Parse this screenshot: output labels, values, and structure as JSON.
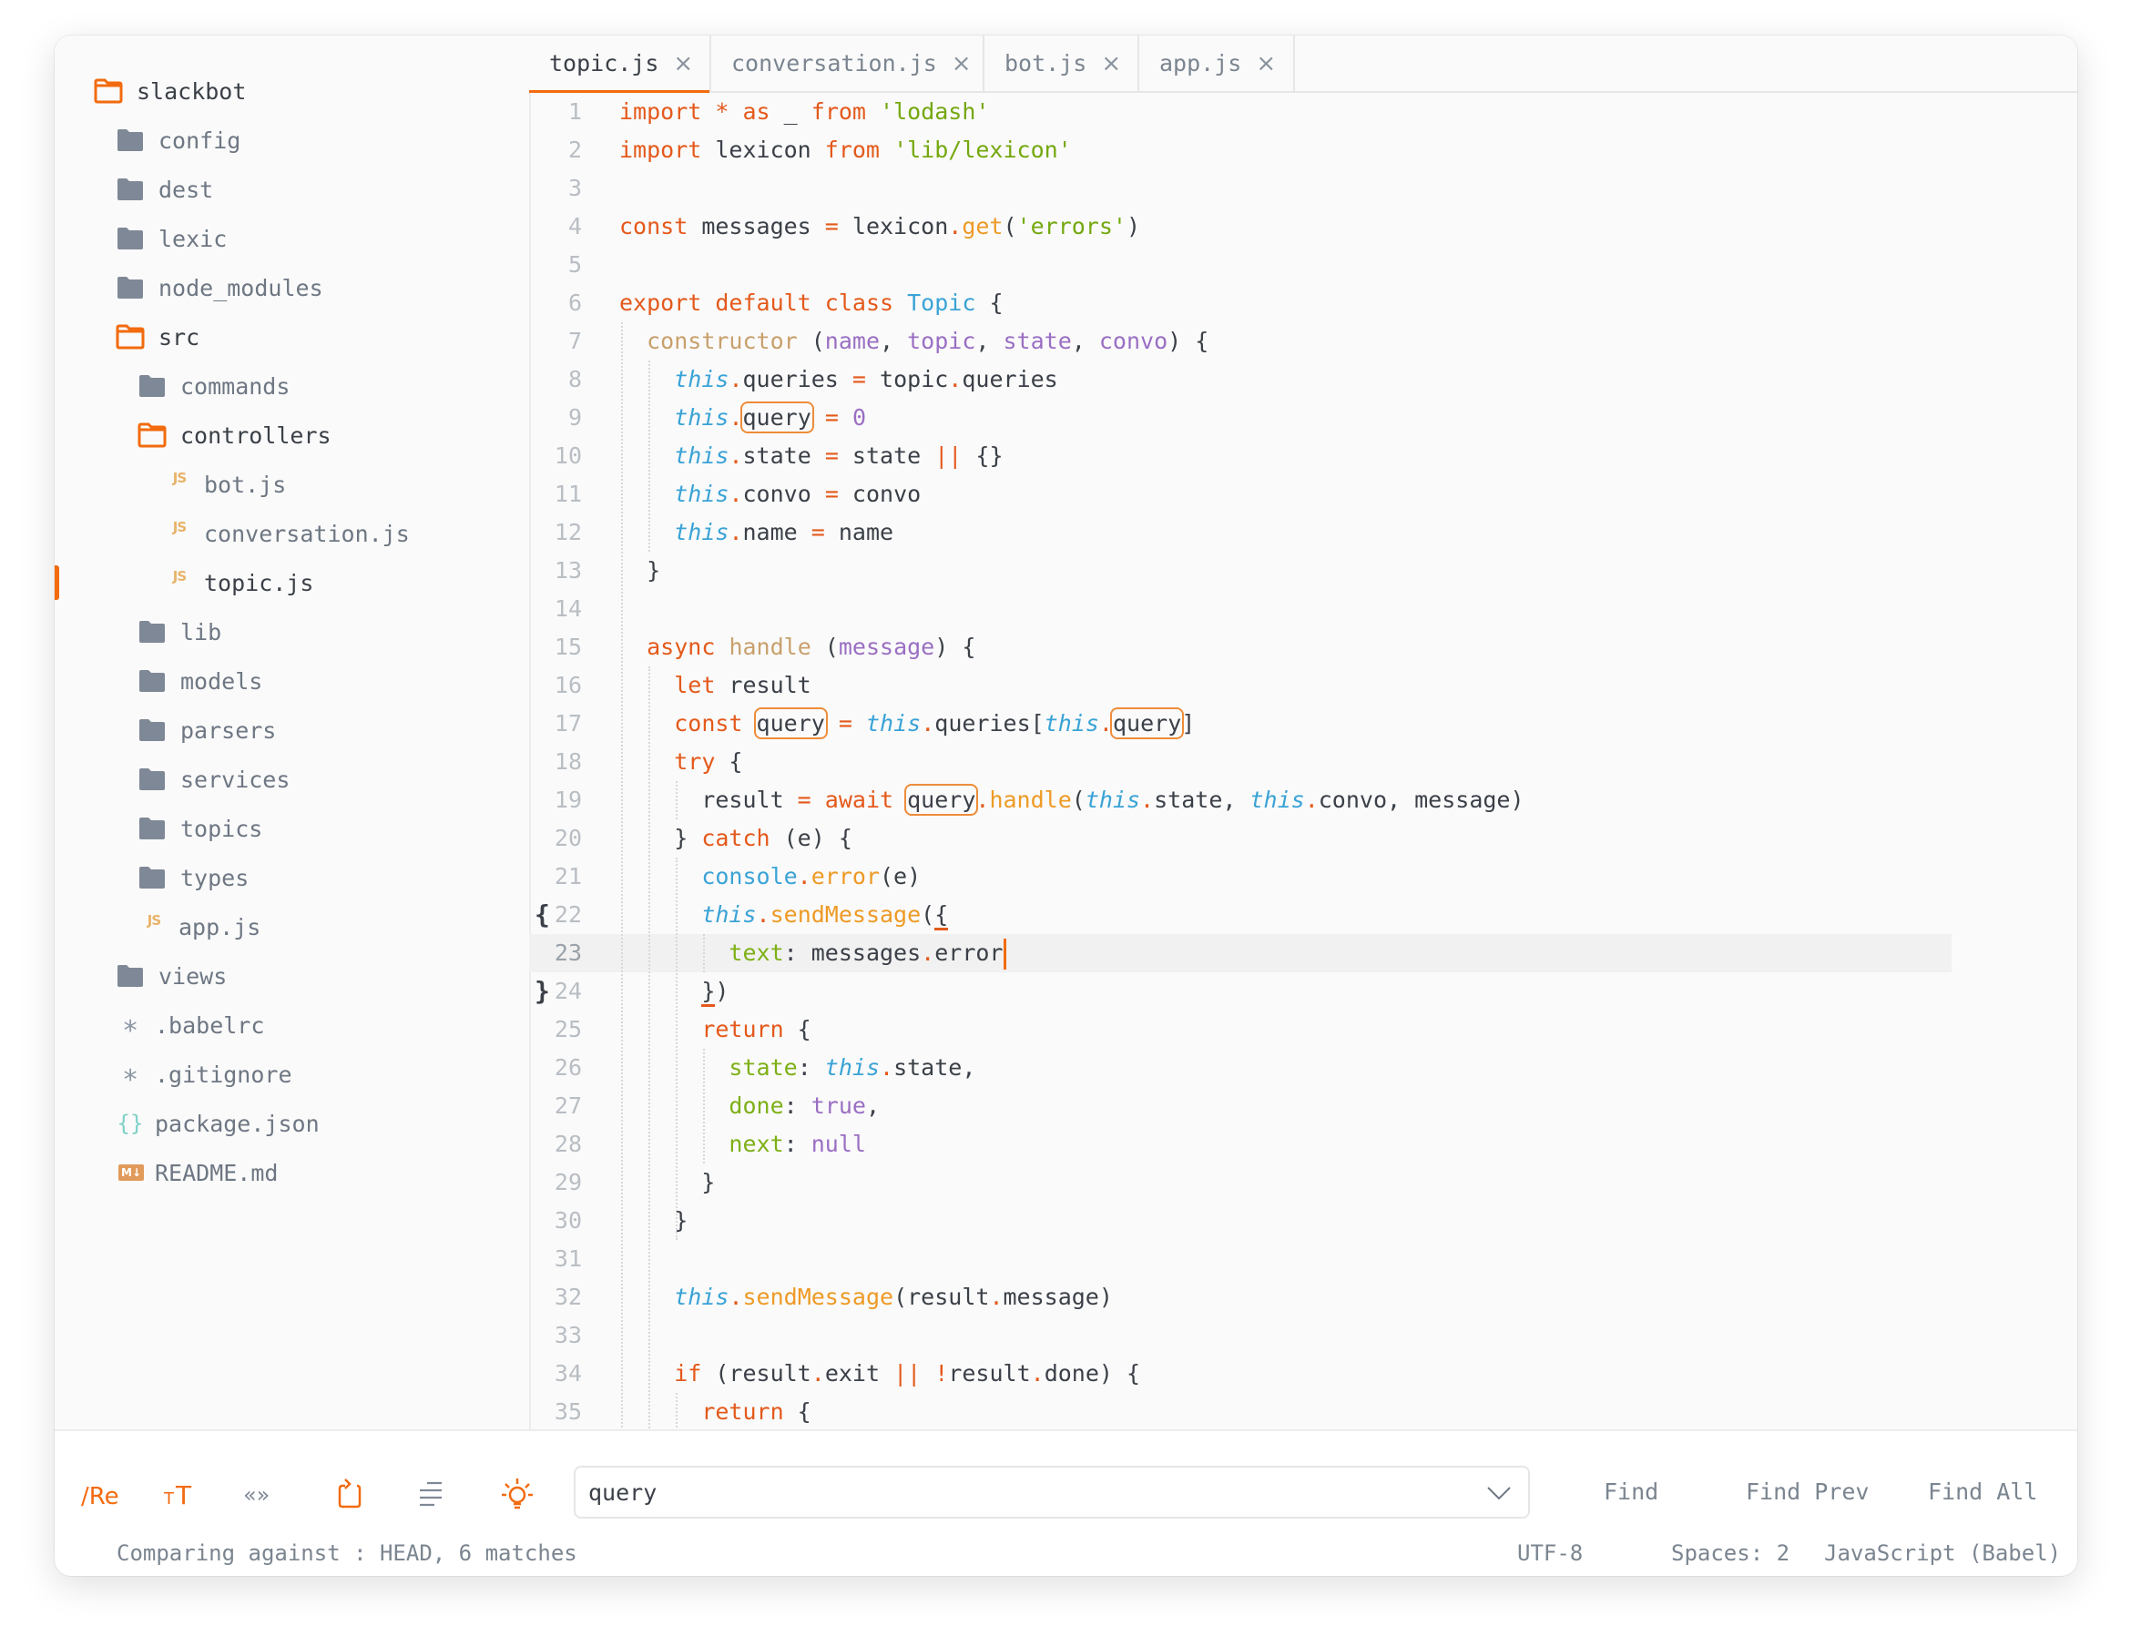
{
  "sidebar": {
    "items": [
      {
        "label": "slackbot",
        "icon": "folder-open-icon",
        "kind": "folder-open",
        "depth": 0
      },
      {
        "label": "config",
        "icon": "folder-icon",
        "kind": "folder",
        "depth": 1
      },
      {
        "label": "dest",
        "icon": "folder-icon",
        "kind": "folder",
        "depth": 1
      },
      {
        "label": "lexic",
        "icon": "folder-icon",
        "kind": "folder",
        "depth": 1
      },
      {
        "label": "node_modules",
        "icon": "folder-icon",
        "kind": "folder",
        "depth": 1
      },
      {
        "label": "src",
        "icon": "folder-open-icon",
        "kind": "folder-open",
        "depth": 1
      },
      {
        "label": "commands",
        "icon": "folder-icon",
        "kind": "folder",
        "depth": 2
      },
      {
        "label": "controllers",
        "icon": "folder-open-icon",
        "kind": "folder-open",
        "depth": 2
      },
      {
        "label": "bot.js",
        "icon": "js-file-icon",
        "kind": "js",
        "depth": 3
      },
      {
        "label": "conversation.js",
        "icon": "js-file-icon",
        "kind": "js",
        "depth": 3
      },
      {
        "label": "topic.js",
        "icon": "js-file-icon",
        "kind": "js",
        "depth": 3,
        "active": true
      },
      {
        "label": "lib",
        "icon": "folder-icon",
        "kind": "folder",
        "depth": 2
      },
      {
        "label": "models",
        "icon": "folder-icon",
        "kind": "folder",
        "depth": 2
      },
      {
        "label": "parsers",
        "icon": "folder-icon",
        "kind": "folder",
        "depth": 2
      },
      {
        "label": "services",
        "icon": "folder-icon",
        "kind": "folder",
        "depth": 2
      },
      {
        "label": "topics",
        "icon": "folder-icon",
        "kind": "folder",
        "depth": 2
      },
      {
        "label": "types",
        "icon": "folder-icon",
        "kind": "folder",
        "depth": 2
      },
      {
        "label": "app.js",
        "icon": "js-file-icon",
        "kind": "js",
        "depth": 2
      },
      {
        "label": "views",
        "icon": "folder-icon",
        "kind": "folder",
        "depth": 1
      },
      {
        "label": ".babelrc",
        "icon": "asterisk-icon",
        "kind": "star",
        "depth": 1
      },
      {
        "label": ".gitignore",
        "icon": "asterisk-icon",
        "kind": "star",
        "depth": 1
      },
      {
        "label": "package.json",
        "icon": "json-braces-icon",
        "kind": "json",
        "depth": 1
      },
      {
        "label": "README.md",
        "icon": "markdown-icon",
        "kind": "md",
        "depth": 1
      }
    ],
    "js_badge": "JS",
    "md_badge": "M↓"
  },
  "tabs": [
    {
      "label": "topic.js",
      "active": true
    },
    {
      "label": "conversation.js",
      "active": false
    },
    {
      "label": "bot.js",
      "active": false
    },
    {
      "label": "app.js",
      "active": false
    }
  ],
  "editor": {
    "current_line": 23,
    "fold_markers": {
      "22": "{",
      "24": "}"
    },
    "lines": [
      [
        [
          "k",
          "import"
        ],
        [
          "t",
          " "
        ],
        [
          "k",
          "*"
        ],
        [
          "t",
          " "
        ],
        [
          "k",
          "as"
        ],
        [
          "t",
          " _ "
        ],
        [
          "k",
          "from"
        ],
        [
          "t",
          " "
        ],
        [
          "s",
          "'lodash'"
        ]
      ],
      [
        [
          "k",
          "import"
        ],
        [
          "t",
          " lexicon "
        ],
        [
          "k",
          "from"
        ],
        [
          "t",
          " "
        ],
        [
          "s",
          "'lib/lexicon'"
        ]
      ],
      [],
      [
        [
          "k",
          "const"
        ],
        [
          "t",
          " messages "
        ],
        [
          "op",
          "="
        ],
        [
          "t",
          " lexicon"
        ],
        [
          "op",
          "."
        ],
        [
          "f",
          "get"
        ],
        [
          "t",
          "("
        ],
        [
          "s",
          "'errors'"
        ],
        [
          "t",
          ")"
        ]
      ],
      [],
      [
        [
          "k",
          "export"
        ],
        [
          "t",
          " "
        ],
        [
          "k",
          "default"
        ],
        [
          "t",
          " "
        ],
        [
          "k",
          "class"
        ],
        [
          "t",
          " "
        ],
        [
          "cls",
          "Topic"
        ],
        [
          "t",
          " {"
        ]
      ],
      [
        [
          "t",
          "  "
        ],
        [
          "ctor",
          "constructor"
        ],
        [
          "t",
          " ("
        ],
        [
          "p",
          "name"
        ],
        [
          "t",
          ", "
        ],
        [
          "p",
          "topic"
        ],
        [
          "t",
          ", "
        ],
        [
          "p",
          "state"
        ],
        [
          "t",
          ", "
        ],
        [
          "p",
          "convo"
        ],
        [
          "t",
          ") {"
        ]
      ],
      [
        [
          "t",
          "    "
        ],
        [
          "th",
          "this"
        ],
        [
          "op",
          "."
        ],
        [
          "t",
          "queries "
        ],
        [
          "op",
          "="
        ],
        [
          "t",
          " topic"
        ],
        [
          "op",
          "."
        ],
        [
          "t",
          "queries"
        ]
      ],
      [
        [
          "t",
          "    "
        ],
        [
          "th",
          "this"
        ],
        [
          "op",
          "."
        ],
        [
          "m",
          "query"
        ],
        [
          "t",
          " "
        ],
        [
          "op",
          "="
        ],
        [
          "t",
          " "
        ],
        [
          "p",
          "0"
        ]
      ],
      [
        [
          "t",
          "    "
        ],
        [
          "th",
          "this"
        ],
        [
          "op",
          "."
        ],
        [
          "t",
          "state "
        ],
        [
          "op",
          "="
        ],
        [
          "t",
          " state "
        ],
        [
          "op",
          "||"
        ],
        [
          "t",
          " {}"
        ]
      ],
      [
        [
          "t",
          "    "
        ],
        [
          "th",
          "this"
        ],
        [
          "op",
          "."
        ],
        [
          "t",
          "convo "
        ],
        [
          "op",
          "="
        ],
        [
          "t",
          " convo"
        ]
      ],
      [
        [
          "t",
          "    "
        ],
        [
          "th",
          "this"
        ],
        [
          "op",
          "."
        ],
        [
          "t",
          "name "
        ],
        [
          "op",
          "="
        ],
        [
          "t",
          " name"
        ]
      ],
      [
        [
          "t",
          "  }"
        ]
      ],
      [],
      [
        [
          "t",
          "  "
        ],
        [
          "k",
          "async"
        ],
        [
          "t",
          " "
        ],
        [
          "ctor",
          "handle"
        ],
        [
          "t",
          " ("
        ],
        [
          "p",
          "message"
        ],
        [
          "t",
          ") {"
        ]
      ],
      [
        [
          "t",
          "    "
        ],
        [
          "k",
          "let"
        ],
        [
          "t",
          " result"
        ]
      ],
      [
        [
          "t",
          "    "
        ],
        [
          "k",
          "const"
        ],
        [
          "t",
          " "
        ],
        [
          "m",
          "query"
        ],
        [
          "t",
          " "
        ],
        [
          "op",
          "="
        ],
        [
          "t",
          " "
        ],
        [
          "th",
          "this"
        ],
        [
          "op",
          "."
        ],
        [
          "t",
          "queries["
        ],
        [
          "th",
          "this"
        ],
        [
          "op",
          "."
        ],
        [
          "m",
          "query"
        ],
        [
          "t",
          "]"
        ]
      ],
      [
        [
          "t",
          "    "
        ],
        [
          "k",
          "try"
        ],
        [
          "t",
          " {"
        ]
      ],
      [
        [
          "t",
          "      result "
        ],
        [
          "op",
          "="
        ],
        [
          "t",
          " "
        ],
        [
          "k",
          "await"
        ],
        [
          "t",
          " "
        ],
        [
          "m",
          "query"
        ],
        [
          "op",
          "."
        ],
        [
          "f",
          "handle"
        ],
        [
          "t",
          "("
        ],
        [
          "th",
          "this"
        ],
        [
          "op",
          "."
        ],
        [
          "t",
          "state, "
        ],
        [
          "th",
          "this"
        ],
        [
          "op",
          "."
        ],
        [
          "t",
          "convo, message)"
        ]
      ],
      [
        [
          "t",
          "    } "
        ],
        [
          "k",
          "catch"
        ],
        [
          "t",
          " (e) {"
        ]
      ],
      [
        [
          "t",
          "      "
        ],
        [
          "gl",
          "console"
        ],
        [
          "op",
          "."
        ],
        [
          "f",
          "error"
        ],
        [
          "t",
          "(e)"
        ]
      ],
      [
        [
          "t",
          "      "
        ],
        [
          "th",
          "this"
        ],
        [
          "op",
          "."
        ],
        [
          "f",
          "sendMessage"
        ],
        [
          "t",
          "("
        ],
        [
          "b",
          "{"
        ]
      ],
      [
        [
          "t",
          "        "
        ],
        [
          "prop",
          "text"
        ],
        [
          "t",
          ": messages"
        ],
        [
          "op",
          "."
        ],
        [
          "t",
          "error"
        ],
        [
          "cur",
          ""
        ]
      ],
      [
        [
          "t",
          "      "
        ],
        [
          "b",
          "}"
        ],
        [
          "t",
          ")"
        ]
      ],
      [
        [
          "t",
          "      "
        ],
        [
          "k",
          "return"
        ],
        [
          "t",
          " {"
        ]
      ],
      [
        [
          "t",
          "        "
        ],
        [
          "prop",
          "state"
        ],
        [
          "t",
          ": "
        ],
        [
          "th",
          "this"
        ],
        [
          "op",
          "."
        ],
        [
          "t",
          "state,"
        ]
      ],
      [
        [
          "t",
          "        "
        ],
        [
          "prop",
          "done"
        ],
        [
          "t",
          ": "
        ],
        [
          "p",
          "true"
        ],
        [
          "t",
          ","
        ]
      ],
      [
        [
          "t",
          "        "
        ],
        [
          "prop",
          "next"
        ],
        [
          "t",
          ": "
        ],
        [
          "p",
          "null"
        ]
      ],
      [
        [
          "t",
          "      }"
        ]
      ],
      [
        [
          "t",
          "    }"
        ]
      ],
      [],
      [
        [
          "t",
          "    "
        ],
        [
          "th",
          "this"
        ],
        [
          "op",
          "."
        ],
        [
          "f",
          "sendMessage"
        ],
        [
          "t",
          "(result"
        ],
        [
          "op",
          "."
        ],
        [
          "t",
          "message)"
        ]
      ],
      [],
      [
        [
          "t",
          "    "
        ],
        [
          "k",
          "if"
        ],
        [
          "t",
          " (result"
        ],
        [
          "op",
          "."
        ],
        [
          "t",
          "exit "
        ],
        [
          "op",
          "||"
        ],
        [
          "t",
          " "
        ],
        [
          "op",
          "!"
        ],
        [
          "t",
          "result"
        ],
        [
          "op",
          "."
        ],
        [
          "t",
          "done) {"
        ]
      ],
      [
        [
          "t",
          "      "
        ],
        [
          "k",
          "return"
        ],
        [
          "t",
          " {"
        ]
      ]
    ]
  },
  "findbar": {
    "tools": [
      {
        "name": "regex-toggle-icon",
        "glyph": "/Re",
        "active": true
      },
      {
        "name": "case-sensitive-icon",
        "glyph": "тT",
        "active": true
      },
      {
        "name": "whole-word-icon",
        "glyph": "«»",
        "active": false
      },
      {
        "name": "wrap-around-icon",
        "glyph": "wrap",
        "active": true
      },
      {
        "name": "in-selection-icon",
        "glyph": "lines",
        "active": false
      },
      {
        "name": "highlight-matches-icon",
        "glyph": "bulb",
        "active": true
      }
    ],
    "query": "query",
    "find_label": "Find",
    "find_prev_label": "Find Prev",
    "find_all_label": "Find All"
  },
  "status": {
    "left": "Comparing against : HEAD, 6 matches",
    "encoding": "UTF-8",
    "indent": "Spaces: 2",
    "syntax": "JavaScript (Babel)"
  },
  "colors": {
    "accent": "#f26b0f",
    "keyword": "#e4591b",
    "string": "#74a80f",
    "function": "#ee9a26",
    "class": "#3aa3d6",
    "param": "#9a6fc3",
    "property": "#7db016",
    "text": "#3b4048",
    "muted": "#7b8590"
  }
}
